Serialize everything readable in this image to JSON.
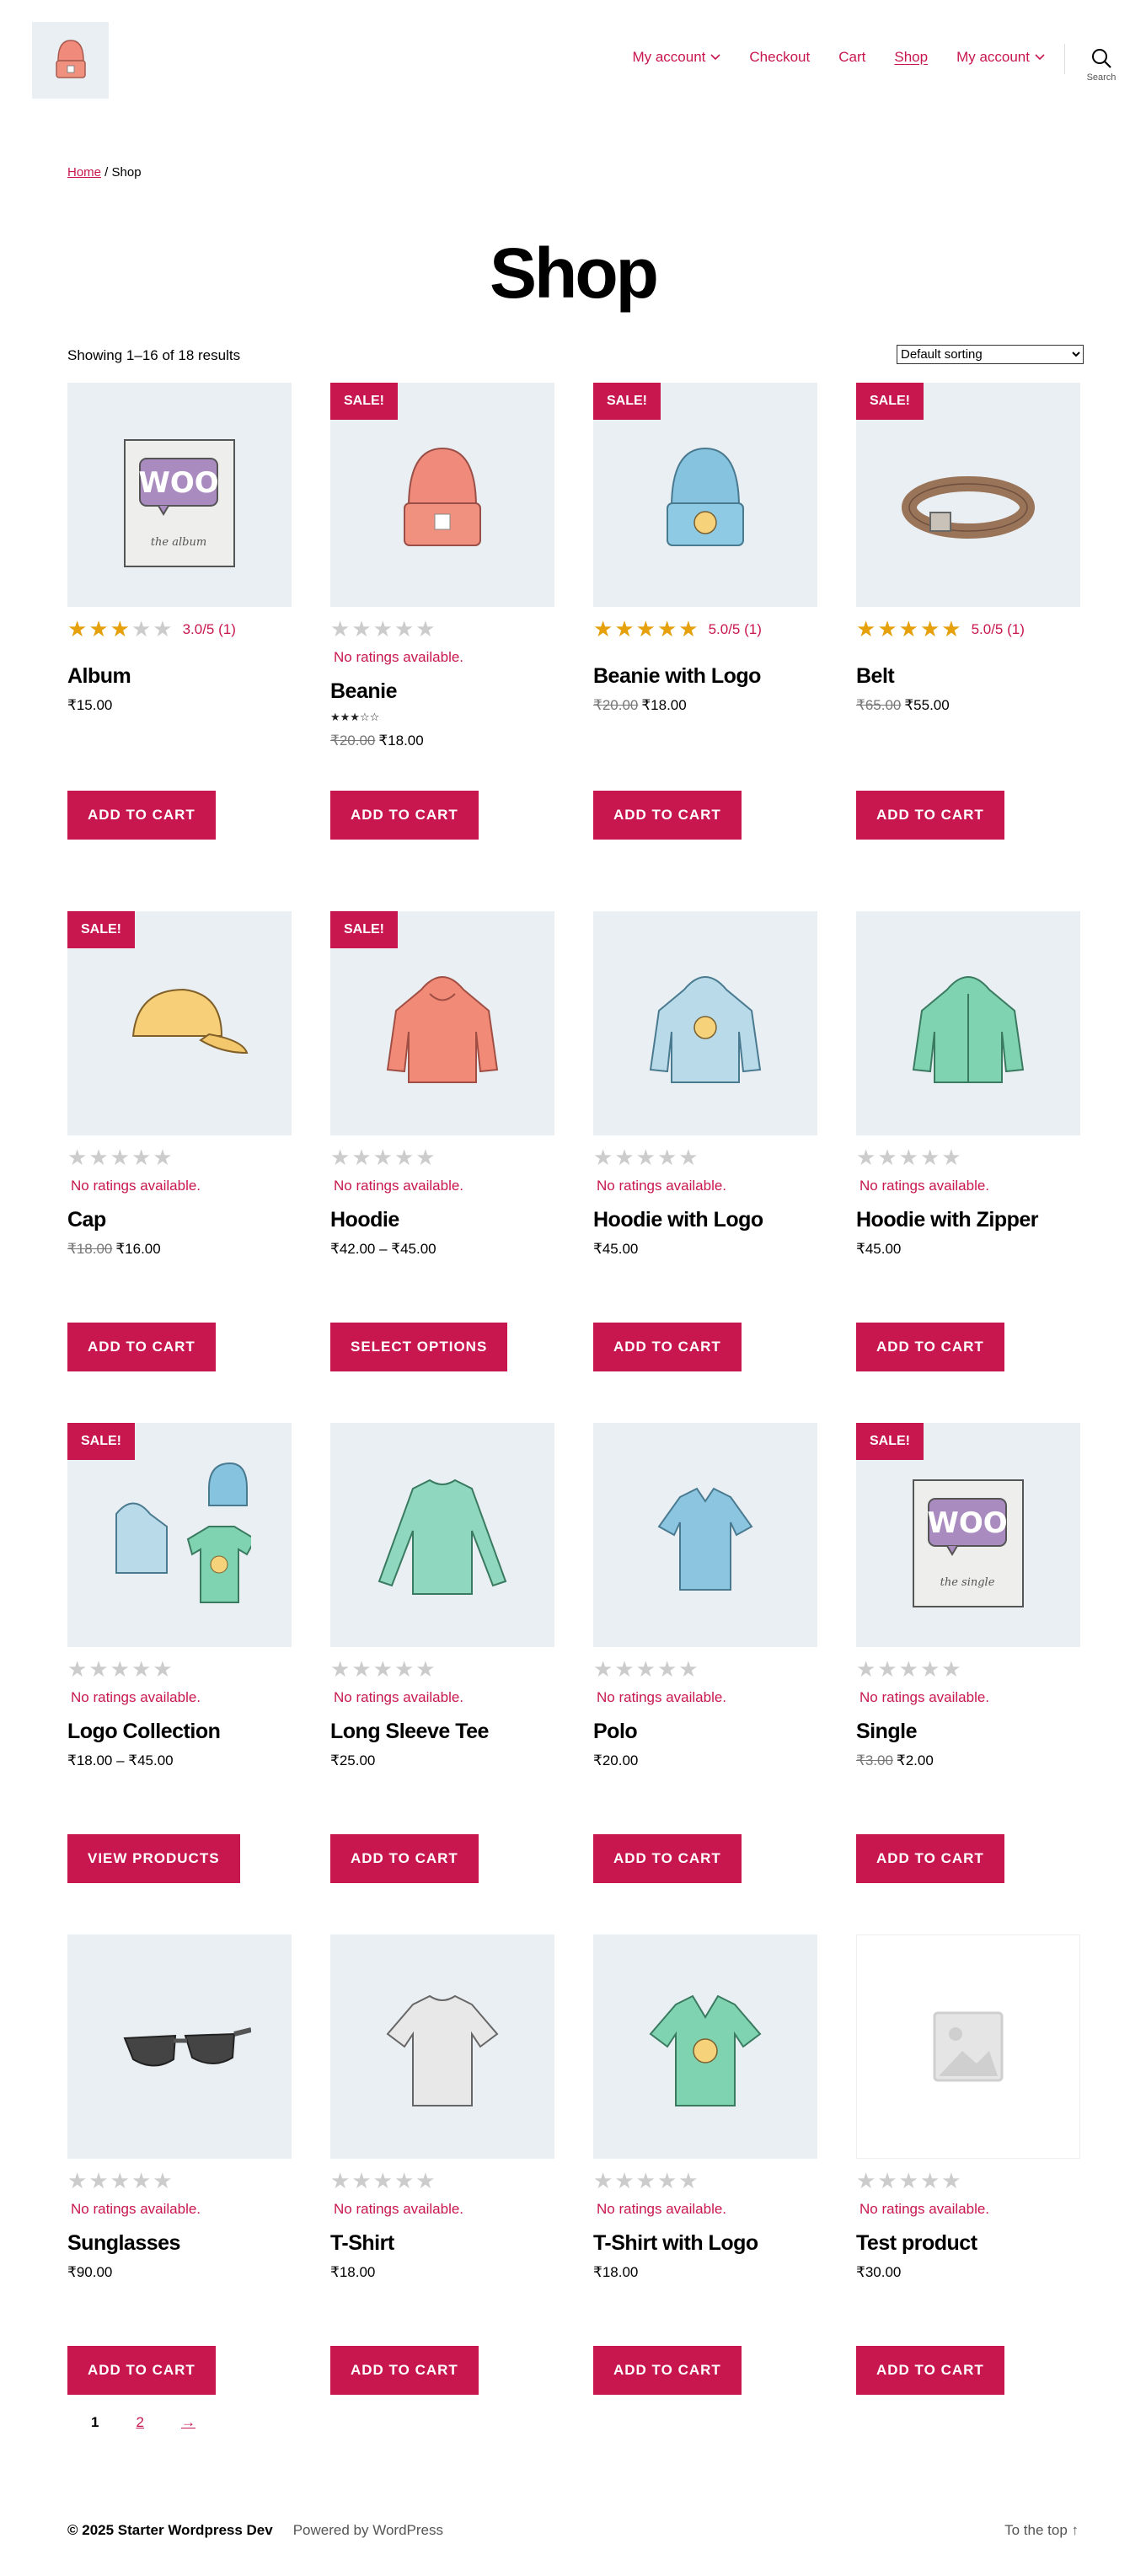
{
  "header": {
    "logo_icon": "beanie-logo-icon",
    "nav": [
      {
        "label": "My account",
        "has_dropdown": true
      },
      {
        "label": "Checkout",
        "has_dropdown": false
      },
      {
        "label": "Cart",
        "has_dropdown": false
      },
      {
        "label": "Shop",
        "has_dropdown": false,
        "current": true
      },
      {
        "label": "My account",
        "has_dropdown": true
      }
    ],
    "search_label": "Search"
  },
  "breadcrumb": {
    "home": "Home",
    "separator": " / ",
    "current": "Shop"
  },
  "page_title": "Shop",
  "result_count": "Showing 1–16 of 18 results",
  "sorting": {
    "selected": "Default sorting"
  },
  "colors": {
    "accent": "#c8174e",
    "star": "#e5a00b",
    "image_bg": "#e9eff3"
  },
  "products": [
    {
      "name": "Album",
      "price": "₹15.00",
      "old_price": "",
      "sale": false,
      "rating": 3,
      "rating_text": "3.0/5 (1)",
      "no_ratings": "",
      "mini_stars": "",
      "button": "ADD TO CART",
      "icon": "album-icon"
    },
    {
      "name": "Beanie",
      "price": "₹18.00",
      "old_price": "₹20.00",
      "sale": true,
      "rating": 0,
      "rating_text": "",
      "no_ratings": "No ratings available.",
      "mini_stars": "★★★☆☆",
      "button": "ADD TO CART",
      "icon": "beanie-icon"
    },
    {
      "name": "Beanie with Logo",
      "price": "₹18.00",
      "old_price": "₹20.00",
      "sale": true,
      "rating": 5,
      "rating_text": "5.0/5 (1)",
      "no_ratings": "",
      "mini_stars": "",
      "button": "ADD TO CART",
      "icon": "beanie-logo-icon"
    },
    {
      "name": "Belt",
      "price": "₹55.00",
      "old_price": "₹65.00",
      "sale": true,
      "rating": 5,
      "rating_text": "5.0/5 (1)",
      "no_ratings": "",
      "mini_stars": "",
      "button": "ADD TO CART",
      "icon": "belt-icon"
    },
    {
      "name": "Cap",
      "price": "₹16.00",
      "old_price": "₹18.00",
      "sale": true,
      "rating": 0,
      "rating_text": "",
      "no_ratings": "No ratings available.",
      "mini_stars": "",
      "button": "ADD TO CART",
      "icon": "cap-icon"
    },
    {
      "name": "Hoodie",
      "price": "₹42.00 – ₹45.00",
      "old_price": "",
      "sale": true,
      "rating": 0,
      "rating_text": "",
      "no_ratings": "No ratings available.",
      "mini_stars": "",
      "button": "SELECT OPTIONS",
      "icon": "hoodie-icon"
    },
    {
      "name": "Hoodie with Logo",
      "price": "₹45.00",
      "old_price": "",
      "sale": false,
      "rating": 0,
      "rating_text": "",
      "no_ratings": "No ratings available.",
      "mini_stars": "",
      "button": "ADD TO CART",
      "icon": "hoodie-logo-icon"
    },
    {
      "name": "Hoodie with Zipper",
      "price": "₹45.00",
      "old_price": "",
      "sale": false,
      "rating": 0,
      "rating_text": "",
      "no_ratings": "No ratings available.",
      "mini_stars": "",
      "button": "ADD TO CART",
      "icon": "hoodie-zipper-icon"
    },
    {
      "name": "Logo Collection",
      "price": "₹18.00 – ₹45.00",
      "old_price": "",
      "sale": true,
      "rating": 0,
      "rating_text": "",
      "no_ratings": "No ratings available.",
      "mini_stars": "",
      "button": "VIEW PRODUCTS",
      "icon": "logo-collection-icon"
    },
    {
      "name": "Long Sleeve Tee",
      "price": "₹25.00",
      "old_price": "",
      "sale": false,
      "rating": 0,
      "rating_text": "",
      "no_ratings": "No ratings available.",
      "mini_stars": "",
      "button": "ADD TO CART",
      "icon": "long-sleeve-tee-icon"
    },
    {
      "name": "Polo",
      "price": "₹20.00",
      "old_price": "",
      "sale": false,
      "rating": 0,
      "rating_text": "",
      "no_ratings": "No ratings available.",
      "mini_stars": "",
      "button": "ADD TO CART",
      "icon": "polo-icon"
    },
    {
      "name": "Single",
      "price": "₹2.00",
      "old_price": "₹3.00",
      "sale": true,
      "rating": 0,
      "rating_text": "",
      "no_ratings": "No ratings available.",
      "mini_stars": "",
      "button": "ADD TO CART",
      "icon": "single-icon"
    },
    {
      "name": "Sunglasses",
      "price": "₹90.00",
      "old_price": "",
      "sale": false,
      "rating": 0,
      "rating_text": "",
      "no_ratings": "No ratings available.",
      "mini_stars": "",
      "button": "ADD TO CART",
      "icon": "sunglasses-icon"
    },
    {
      "name": "T-Shirt",
      "price": "₹18.00",
      "old_price": "",
      "sale": false,
      "rating": 0,
      "rating_text": "",
      "no_ratings": "No ratings available.",
      "mini_stars": "",
      "button": "ADD TO CART",
      "icon": "tshirt-icon"
    },
    {
      "name": "T-Shirt with Logo",
      "price": "₹18.00",
      "old_price": "",
      "sale": false,
      "rating": 0,
      "rating_text": "",
      "no_ratings": "No ratings available.",
      "mini_stars": "",
      "button": "ADD TO CART",
      "icon": "tshirt-logo-icon"
    },
    {
      "name": "Test product",
      "price": "₹30.00",
      "old_price": "",
      "sale": false,
      "rating": 0,
      "rating_text": "",
      "no_ratings": "No ratings available.",
      "mini_stars": "",
      "button": "ADD TO CART",
      "icon": "placeholder-image-icon"
    }
  ],
  "sale_badge": "SALE!",
  "pagination": {
    "current": "1",
    "pages": [
      "2"
    ],
    "next": "→"
  },
  "footer": {
    "copyright": "© 2025 Starter Wordpress Dev",
    "powered": "Powered by WordPress",
    "to_top": "To the top ↑"
  }
}
